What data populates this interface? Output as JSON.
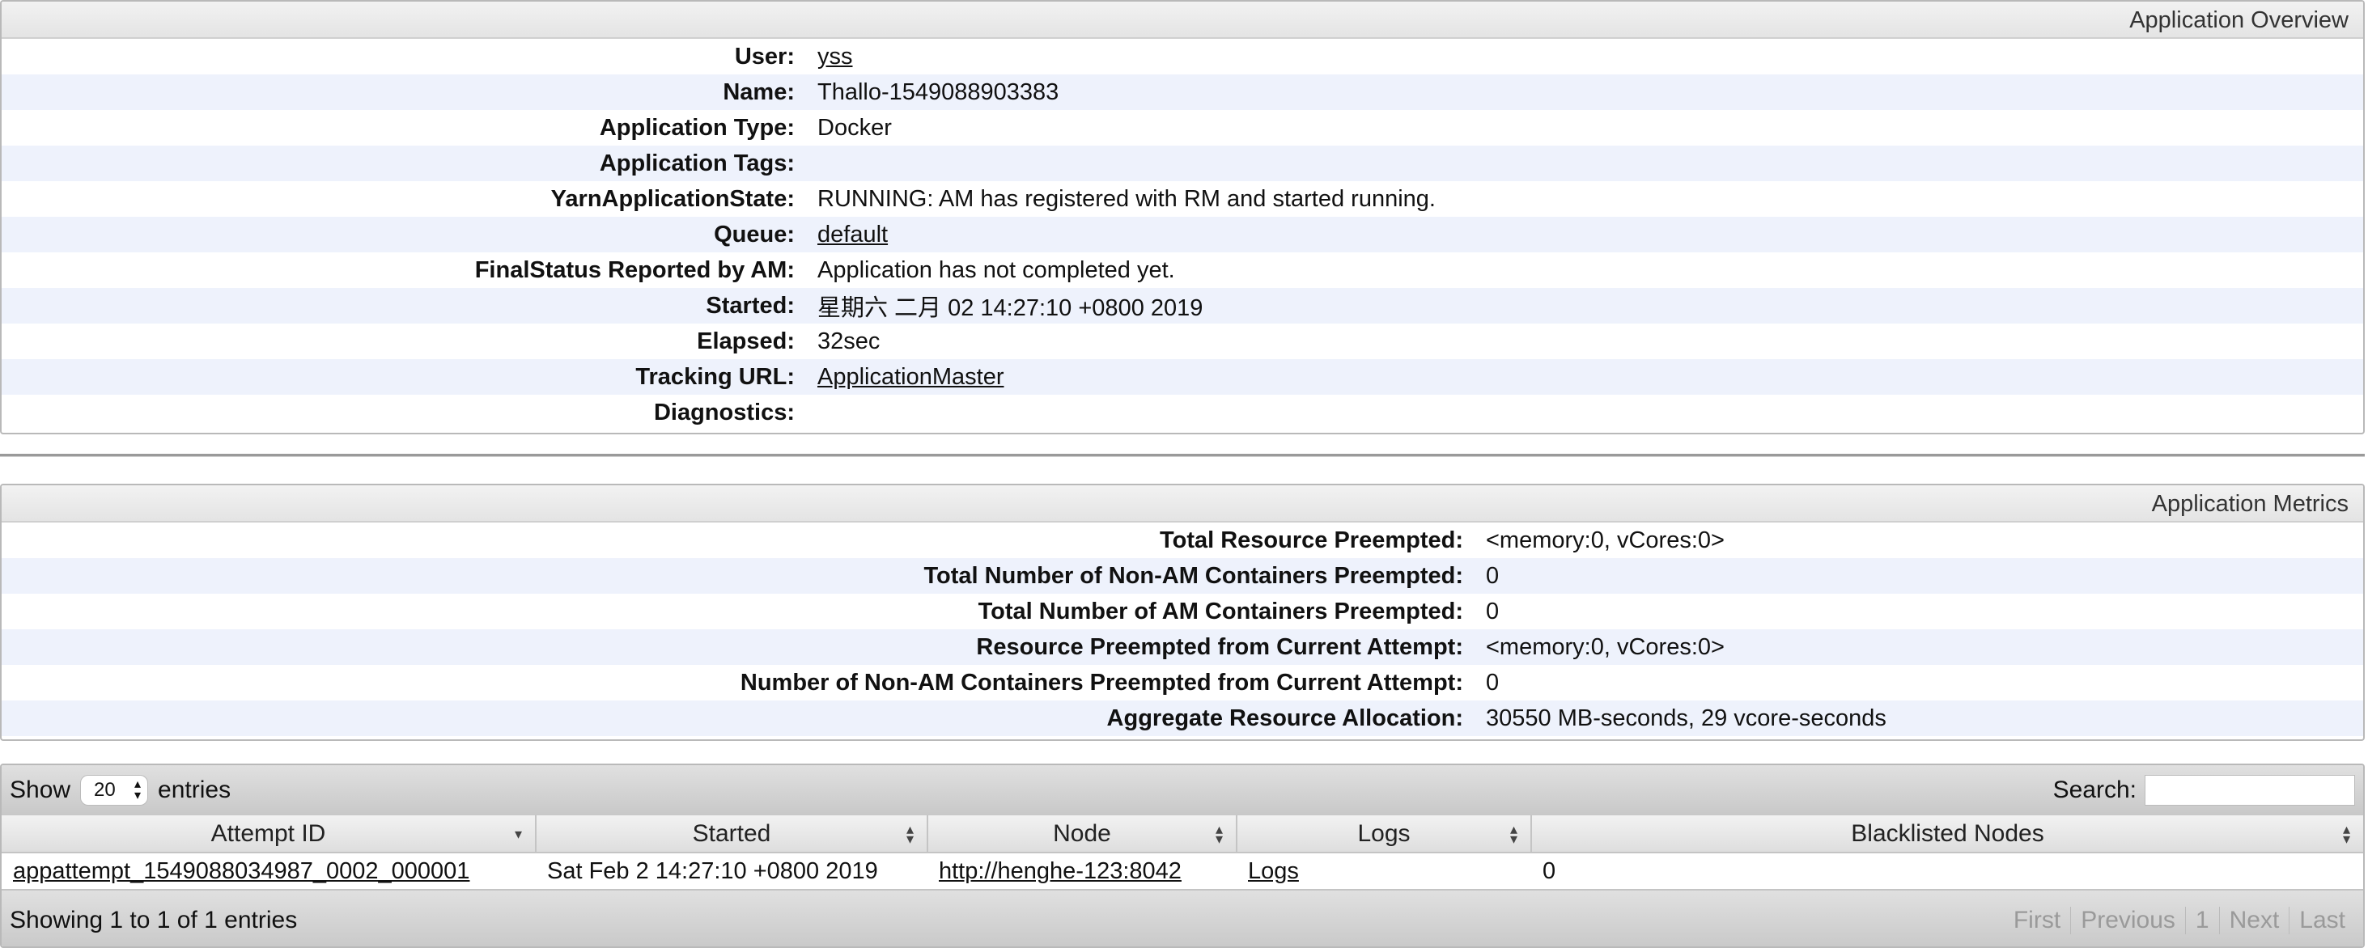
{
  "overview": {
    "title": "Application Overview",
    "rows": [
      {
        "label": "User:",
        "value": "yss",
        "link": true
      },
      {
        "label": "Name:",
        "value": "Thallo-1549088903383"
      },
      {
        "label": "Application Type:",
        "value": "Docker"
      },
      {
        "label": "Application Tags:",
        "value": ""
      },
      {
        "label": "YarnApplicationState:",
        "value": "RUNNING: AM has registered with RM and started running."
      },
      {
        "label": "Queue:",
        "value": "default",
        "link": true
      },
      {
        "label": "FinalStatus Reported by AM:",
        "value": "Application has not completed yet."
      },
      {
        "label": "Started:",
        "value": "星期六 二月 02 14:27:10 +0800 2019"
      },
      {
        "label": "Elapsed:",
        "value": "32sec"
      },
      {
        "label": "Tracking URL:",
        "value": "ApplicationMaster",
        "link": true
      },
      {
        "label": "Diagnostics:",
        "value": ""
      }
    ]
  },
  "metrics": {
    "title": "Application Metrics",
    "rows": [
      {
        "label": "Total Resource Preempted:",
        "value": "<memory:0, vCores:0>"
      },
      {
        "label": "Total Number of Non-AM Containers Preempted:",
        "value": "0"
      },
      {
        "label": "Total Number of AM Containers Preempted:",
        "value": "0"
      },
      {
        "label": "Resource Preempted from Current Attempt:",
        "value": "<memory:0, vCores:0>"
      },
      {
        "label": "Number of Non-AM Containers Preempted from Current Attempt:",
        "value": "0"
      },
      {
        "label": "Aggregate Resource Allocation:",
        "value": "30550 MB-seconds, 29 vcore-seconds"
      }
    ]
  },
  "attempts": {
    "show_label": "Show",
    "page_size": "20",
    "entries_label": "entries",
    "search_label": "Search:",
    "search_value": "",
    "columns": [
      "Attempt ID",
      "Started",
      "Node",
      "Logs",
      "Blacklisted Nodes"
    ],
    "rows": [
      [
        "appattempt_1549088034987_0002_000001",
        "Sat Feb 2 14:27:10 +0800 2019",
        "http://henghe-123:8042",
        "Logs",
        "0"
      ]
    ],
    "summary": "Showing 1 to 1 of 1 entries",
    "pager": {
      "first": "First",
      "previous": "Previous",
      "page": "1",
      "next": "Next",
      "last": "Last"
    }
  }
}
